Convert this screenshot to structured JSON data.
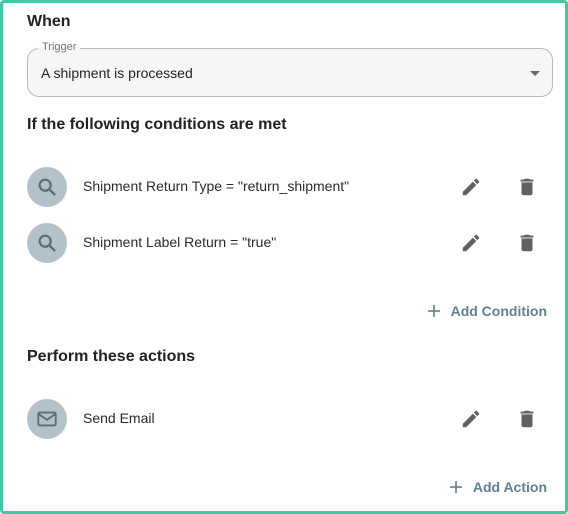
{
  "when": {
    "title": "When",
    "trigger_label": "Trigger",
    "trigger_value": "A shipment is processed"
  },
  "conditions": {
    "title": "If the following conditions are met",
    "items": [
      {
        "text": "Shipment Return Type = \"return_shipment\"",
        "icon": "search-icon"
      },
      {
        "text": "Shipment Label Return = \"true\"",
        "icon": "search-icon"
      }
    ],
    "add_label": "Add Condition"
  },
  "actions": {
    "title": "Perform these actions",
    "items": [
      {
        "text": "Send Email",
        "icon": "mail-icon"
      }
    ],
    "add_label": "Add Action"
  },
  "colors": {
    "frame_border": "#3ec9a7",
    "avatar_bg": "#b3c1ca",
    "link": "#5f7f92",
    "icon": "#616161"
  }
}
